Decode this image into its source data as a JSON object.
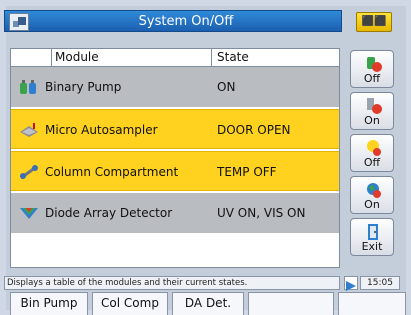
{
  "window": {
    "title": "System On/Off",
    "top_button_label": "⬛⬛"
  },
  "table": {
    "headers": [
      "Module",
      "State"
    ],
    "rows": [
      {
        "module": "Binary Pump",
        "state": "ON",
        "icon": "binary-pump-icon",
        "highlight": "gray"
      },
      {
        "module": "Micro Autosampler",
        "state": "DOOR OPEN",
        "icon": "autosampler-icon",
        "highlight": "yellow"
      },
      {
        "module": "Column Compartment",
        "state": "TEMP OFF",
        "icon": "column-compartment-icon",
        "highlight": "yellow"
      },
      {
        "module": "Diode Array Detector",
        "state": "UV ON, VIS ON",
        "icon": "diode-array-detector-icon",
        "highlight": "gray"
      }
    ]
  },
  "side_buttons": [
    {
      "label": "Off",
      "icon": "pump-off-icon"
    },
    {
      "label": "On",
      "icon": "module-on-icon"
    },
    {
      "label": "Off",
      "icon": "lamp-off-icon"
    },
    {
      "label": "On",
      "icon": "globe-on-icon"
    },
    {
      "label": "Exit",
      "icon": "exit-icon"
    }
  ],
  "status": {
    "text": "Displays a table of the modules and their current states.",
    "time": "15:05"
  },
  "tabs": [
    "Bin Pump",
    "Col Comp",
    "DA Det.",
    "",
    ""
  ],
  "colors": {
    "title_blue": "#1c5fb0",
    "row_gray": "#b9bcc1",
    "row_yellow": "#ffd21f"
  }
}
